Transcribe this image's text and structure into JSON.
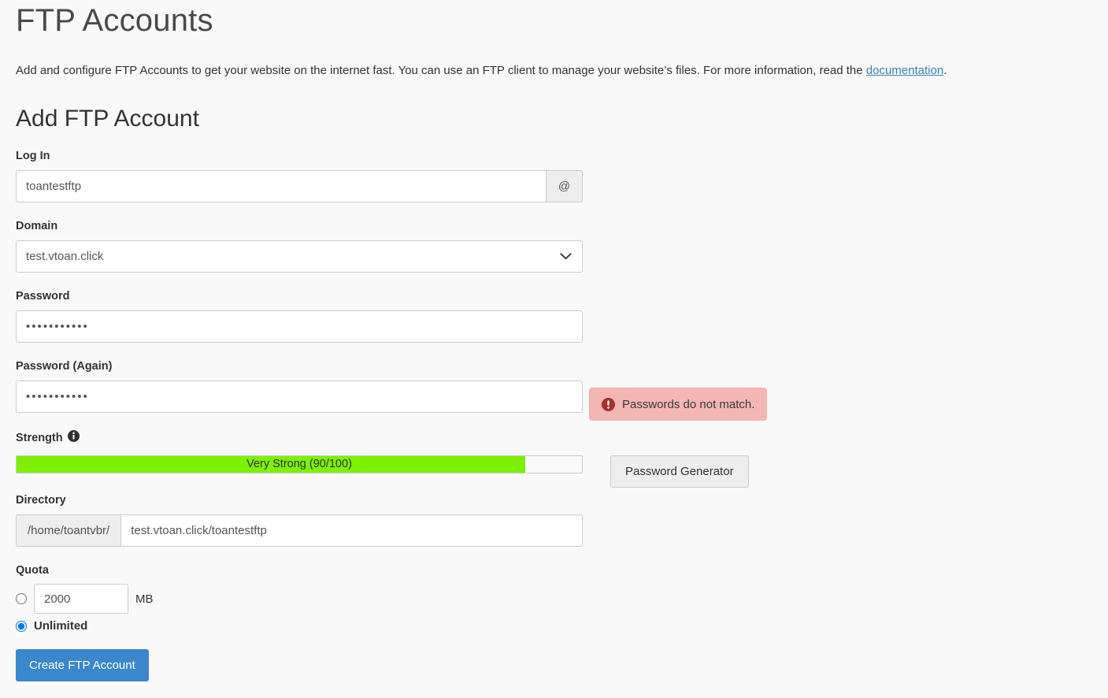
{
  "page": {
    "title": "FTP Accounts",
    "description_before": "Add and configure FTP Accounts to get your website on the internet fast. You can use an FTP client to manage your website’s files. For more information, read the ",
    "description_link": "documentation",
    "description_after": "."
  },
  "form": {
    "heading": "Add FTP Account",
    "login": {
      "label": "Log In",
      "value": "toantestftp",
      "placeholder": "",
      "addon": "@"
    },
    "domain": {
      "label": "Domain",
      "value": "test.vtoan.click",
      "options": [
        "test.vtoan.click"
      ],
      "chevron_icon": "chevron-down-icon"
    },
    "password": {
      "label": "Password",
      "value": "•••••••••••"
    },
    "password_again": {
      "label": "Password (Again)",
      "value": "•••••••••••"
    },
    "alert": {
      "icon": "error-circle-icon",
      "message": "Passwords do not match.",
      "bg_color": "#f3b6b2",
      "icon_color": "#a5302c"
    },
    "strength": {
      "label": "Strength",
      "info_icon": "info-circle-icon",
      "text": "Very Strong (90/100)",
      "score": 90,
      "max": 100,
      "fill_color": "#7ef000"
    },
    "password_generator": {
      "label": "Password Generator"
    },
    "directory": {
      "label": "Directory",
      "prefix": "/home/toantvbr/",
      "value": "test.vtoan.click/toantestftp"
    },
    "quota": {
      "label": "Quota",
      "amount_selected": false,
      "amount_value": "2000",
      "amount_unit": "MB",
      "unlimited_selected": true,
      "unlimited_label": "Unlimited"
    },
    "submit": {
      "label": "Create FTP Account",
      "color": "#3a87cd"
    }
  }
}
